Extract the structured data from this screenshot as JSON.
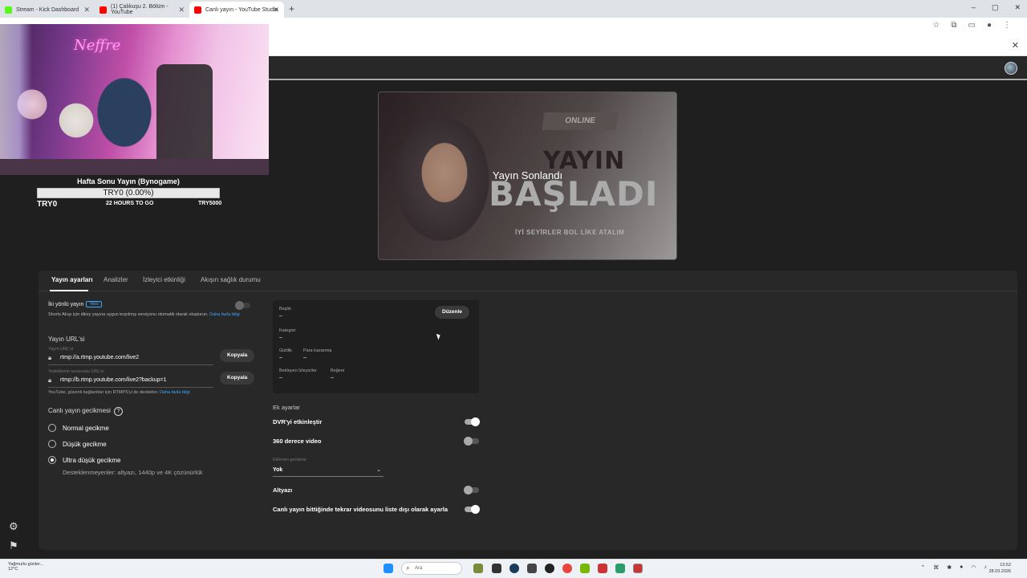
{
  "browser": {
    "tabs": [
      {
        "title": "Stream - Kick Dashboard",
        "color": "#53fc18"
      },
      {
        "title": "(1) Çalıkuşu 2. Bölüm - YouTube",
        "color": "#ff0000"
      },
      {
        "title": "Canlı yayın - YouTube Studio",
        "color": "#ff0000"
      }
    ],
    "new_tab": "+"
  },
  "overlay": {
    "neon_sign": "Neffre",
    "goal_title": "Hafta Sonu Yayın (Bynogame)",
    "goal_bar_text": "TRY0 (0.00%)",
    "goal_progress": 0.0,
    "goal_current": "TRY0",
    "goal_time": "22 HOURS TO GO",
    "goal_target": "TRY5000"
  },
  "preview": {
    "thumb_online": "ONLINE",
    "thumb_yayin": "YAYIN",
    "thumb_basladi": "BAŞLADI",
    "thumb_sub": "İYİ SEYİRLER BOL LİKE ATALIM",
    "status": "Yayın Sonlandı"
  },
  "tabs": [
    "Yayın ayarları",
    "Analizler",
    "İzleyici etkinliği",
    "Akışın sağlık durumu"
  ],
  "left": {
    "two_way_label": "İki yönlü yayın",
    "new_badge": "Yeni",
    "two_way_desc": "Shorts Akışı için dikey yayına uygun kırpılmış versiyonu otomatik olarak oluşturun.",
    "learn_more_1": "Daha fazla",
    "learn_more_2": "bilgi",
    "stream_url_heading": "Yayın URL'si",
    "stream_url_label": "Yayın URL'si",
    "stream_url": "rtmp://a.rtmp.youtube.com/live2",
    "backup_url_label": "Yedekleme sunucusu URL'si",
    "backup_url": "rtmp://b.rtmp.youtube.com/live2?backup=1",
    "copy_label": "Kopyala",
    "rtmps_note": "YouTube, güvenli bağlantılar için RTMPS'yi de destekler.",
    "rtmps_link": "Daha fazla bilgi",
    "latency_heading": "Canlı yayın gecikmesi",
    "latency_options": [
      "Normal gecikme",
      "Düşük gecikme",
      "Ultra düşük gecikme"
    ],
    "latency_selected": 2,
    "latency_note": "Desteklenmeyenler: altyazı, 1440p ve 4K çözünürlük"
  },
  "details": {
    "edit_button": "Düzenle",
    "title_label": "Başlık",
    "title_value": "–",
    "category_label": "Kategori",
    "category_value": "–",
    "privacy_label": "Gizlilik",
    "privacy_value": "–",
    "monetization_label": "Para kazanma",
    "monetization_value": "–",
    "waiting_label": "Bekleyen İzleyiciler",
    "waiting_value": "–",
    "likes_label": "Beğeni",
    "likes_value": "–"
  },
  "extra": {
    "heading": "Ek ayarlar",
    "dvr_label": "DVR'yi etkinleştir",
    "dvr_on": true,
    "v360_label": "360 derece video",
    "v360_on": false,
    "delay_label": "Eklenen gecikme",
    "delay_value": "Yok",
    "captions_label": "Altyazı",
    "captions_on": false,
    "unlist_label": "Canlı yayın bittiğinde tekrar videosunu liste dışı olarak ayarla",
    "unlist_on": true
  },
  "taskbar": {
    "weather_line1": "Yağmurlu günler...",
    "weather_line2": "12°C",
    "search_placeholder": "Ara",
    "time": "13:52",
    "date": "28.03.2026"
  }
}
